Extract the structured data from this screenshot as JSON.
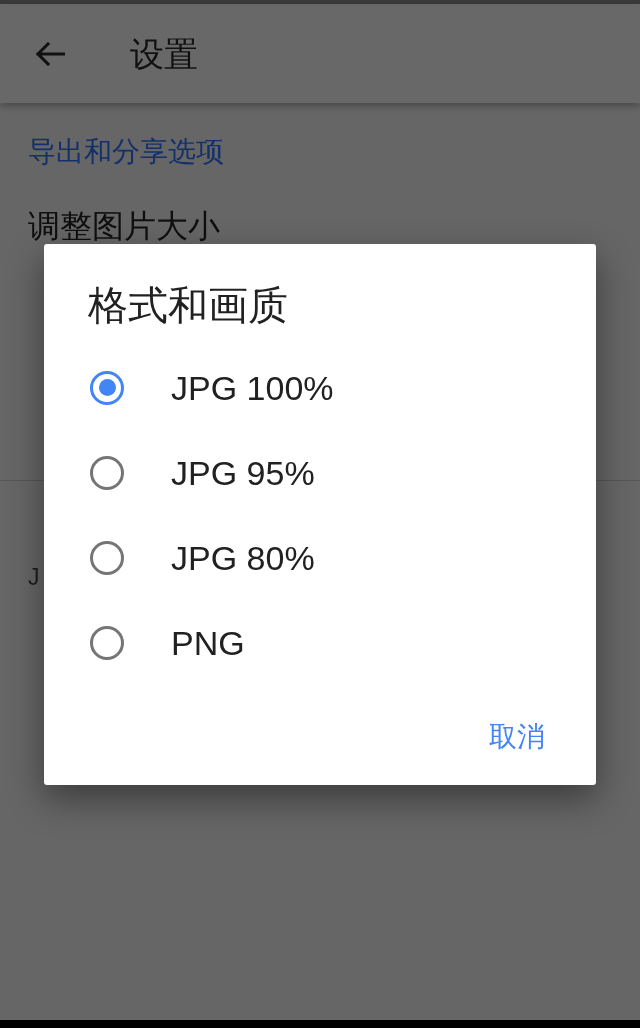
{
  "app_bar": {
    "title": "设置"
  },
  "settings": {
    "section_header": "导出和分享选项",
    "items": [
      {
        "title": "调整图片大小"
      },
      {
        "summary": "J"
      }
    ]
  },
  "dialog": {
    "title": "格式和画质",
    "options": [
      {
        "label": "JPG 100%",
        "selected": true
      },
      {
        "label": "JPG 95%",
        "selected": false
      },
      {
        "label": "JPG 80%",
        "selected": false
      },
      {
        "label": "PNG",
        "selected": false
      }
    ],
    "buttons": [
      "取消"
    ]
  }
}
